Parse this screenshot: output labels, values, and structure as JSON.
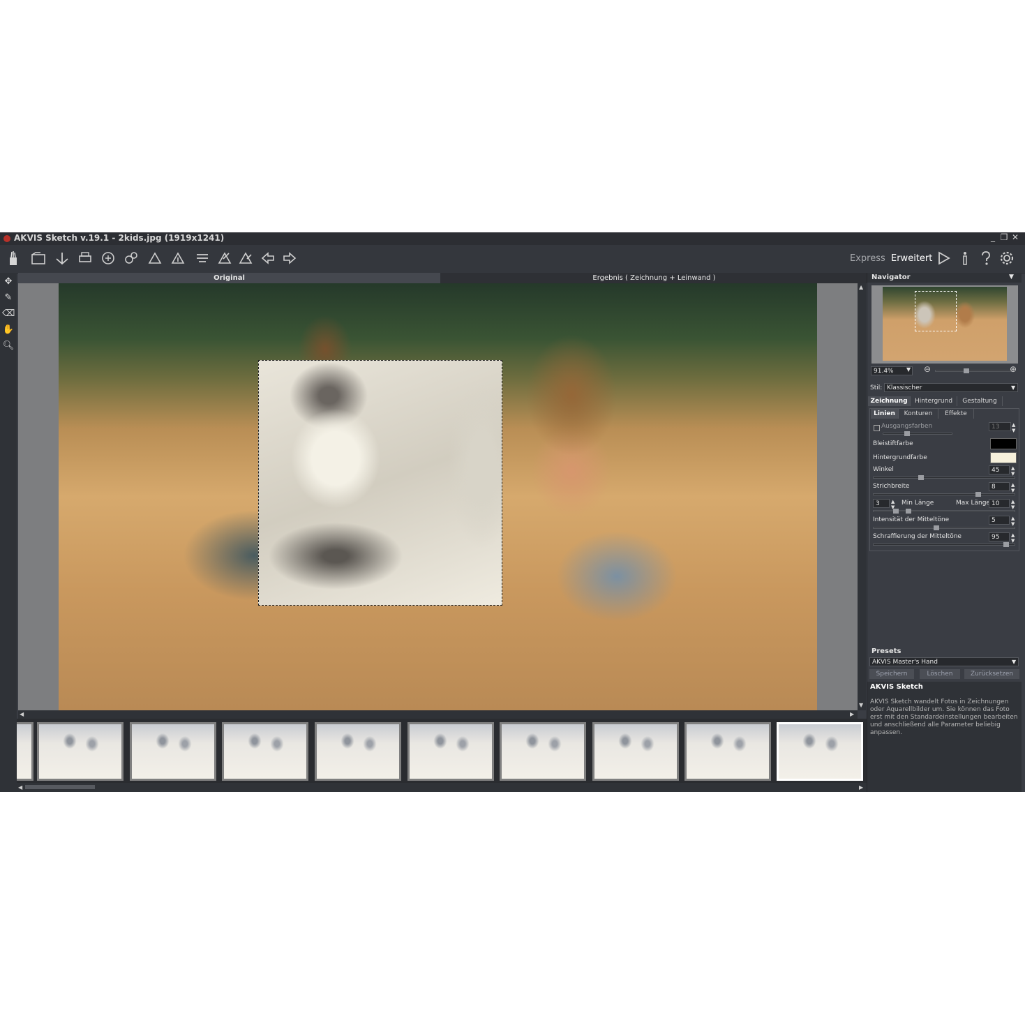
{
  "window": {
    "title": "AKVIS Sketch v.19.1 - 2kids.jpg (1919x1241)",
    "controls": [
      "_",
      "❐",
      "✕"
    ]
  },
  "toolbar": {
    "icons": [
      "open-icon",
      "save-icon",
      "print-icon",
      "share-icon",
      "batch-icon",
      "import-icon",
      "export-icon",
      "hatch-icon",
      "before-icon",
      "after-icon",
      "undo-icon",
      "redo-icon"
    ],
    "express_label": "Express",
    "advanced_label": "Erweitert",
    "run_icon": "play-icon",
    "info_icon": "info-icon",
    "help_icon": "help-icon",
    "settings_icon": "gear-icon"
  },
  "tabs": {
    "original": "Original",
    "result": "Ergebnis ( Zeichnung + Leinwand )"
  },
  "navigator": {
    "title": "Navigator",
    "zoom": "91.4%"
  },
  "style": {
    "label": "Stil:",
    "value": "Klassischer"
  },
  "panel_tabs": [
    "Zeichnung",
    "Hintergrund",
    "Gestaltung"
  ],
  "sub_tabs": [
    "Linien",
    "Konturen",
    "Effekte"
  ],
  "params": {
    "source_colors": {
      "label": "Ausgangsfarben",
      "value": "13",
      "checked": false
    },
    "pencil_color": {
      "label": "Bleistiftfarbe",
      "color": "#000000"
    },
    "bg_color": {
      "label": "Hintergrundfarbe",
      "color": "#f7f1dc"
    },
    "angle": {
      "label": "Winkel",
      "value": "45"
    },
    "stroke_width": {
      "label": "Strichbreite",
      "value": "8"
    },
    "min_length": {
      "label": "Min Länge",
      "value": "3"
    },
    "max_length": {
      "label": "Max Länge",
      "value": "10"
    },
    "midtone_intensity": {
      "label": "Intensität der Mitteltöne",
      "value": "5"
    },
    "midtone_hatching": {
      "label": "Schraffierung der Mitteltöne",
      "value": "95"
    }
  },
  "presets": {
    "title": "Presets",
    "value": "AKVIS Master's Hand",
    "save": "Speichern",
    "delete": "Löschen",
    "reset": "Zurücksetzen"
  },
  "info": {
    "title": "AKVIS Sketch",
    "text": "AKVIS Sketch wandelt Fotos in Zeichnungen oder Aquarellbilder um. Sie können das Foto erst mit den Standardeinstellungen bearbeiten und anschließend alle Parameter beliebig anpassen."
  },
  "filmstrip": {
    "count": 10,
    "selected_index": 9
  },
  "colors": {
    "accent": "#ffffff",
    "panel_bg": "#3a3d44"
  }
}
